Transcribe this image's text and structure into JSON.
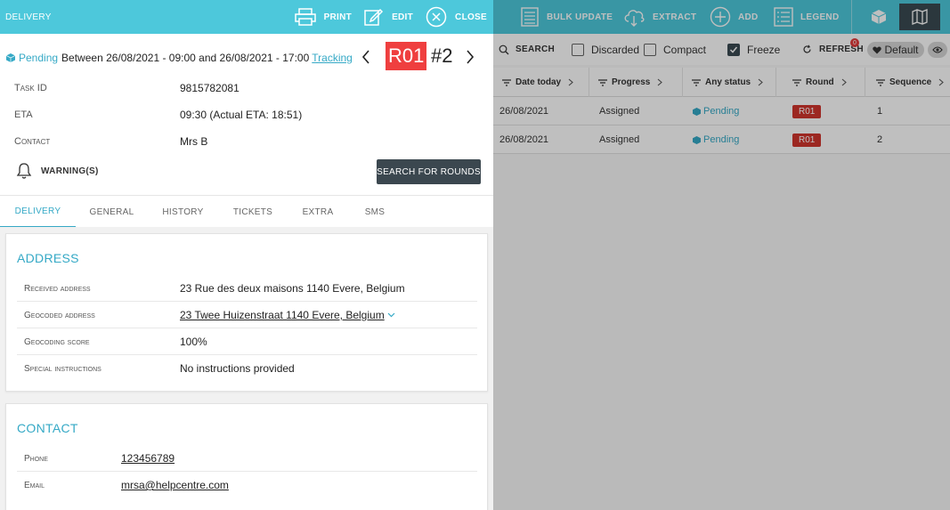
{
  "colors": {
    "accent": "#4dc8db",
    "link": "#35a9c6",
    "round_badge": "#ef3f3f",
    "dark_button": "#3b474f"
  },
  "delivery": {
    "title": "DELIVERY",
    "actions": {
      "print": "PRINT",
      "edit": "EDIT",
      "close": "CLOSE"
    },
    "status": "Pending",
    "window_text": "Between 26/08/2021 - 09:00 and 26/08/2021 - 17:00",
    "tracking_label": "Tracking",
    "round_code": "R01",
    "sequence_label": "#2",
    "task_id_label": "Task ID",
    "task_id": "9815782081",
    "eta_label": "ETA",
    "eta": "09:30 (Actual ETA: 18:51)",
    "contact_label": "Contact",
    "contact": "Mrs B",
    "warnings_label": "WARNING(S)",
    "search_rounds_label": "SEARCH FOR ROUNDS",
    "tabs": [
      "DELIVERY",
      "GENERAL",
      "HISTORY",
      "TICKETS",
      "EXTRA",
      "SMS"
    ],
    "address": {
      "heading": "ADDRESS",
      "received_label": "Received address",
      "received": "23 Rue des deux maisons 1140 Evere, Belgium",
      "geocoded_label": "Geocoded address",
      "geocoded": "23 Twee Huizenstraat 1140 Evere, Belgium",
      "score_label": "Geocoding score",
      "score": "100%",
      "instructions_label": "Special instructions",
      "instructions": "No instructions provided"
    },
    "contact_card": {
      "heading": "CONTACT",
      "phone_label": "Phone",
      "phone": "123456789",
      "email_label": "Email",
      "email": "mrsa@helpcentre.com"
    }
  },
  "list": {
    "actions": {
      "bulk_update": "BULK UPDATE",
      "extract": "EXTRACT",
      "add": "ADD",
      "legend": "LEGEND"
    },
    "toolbar": {
      "search": "SEARCH",
      "discarded": "Discarded",
      "compact": "Compact",
      "freeze": "Freeze",
      "refresh": "REFRESH",
      "refresh_count": "0",
      "default": "Default"
    },
    "columns": [
      "Date today",
      "Progress",
      "Any status",
      "Round",
      "Sequence"
    ],
    "rows": [
      {
        "date": "26/08/2021",
        "progress": "Assigned",
        "status": "Pending",
        "round": "R01",
        "sequence": "1"
      },
      {
        "date": "26/08/2021",
        "progress": "Assigned",
        "status": "Pending",
        "round": "R01",
        "sequence": "2"
      }
    ]
  }
}
